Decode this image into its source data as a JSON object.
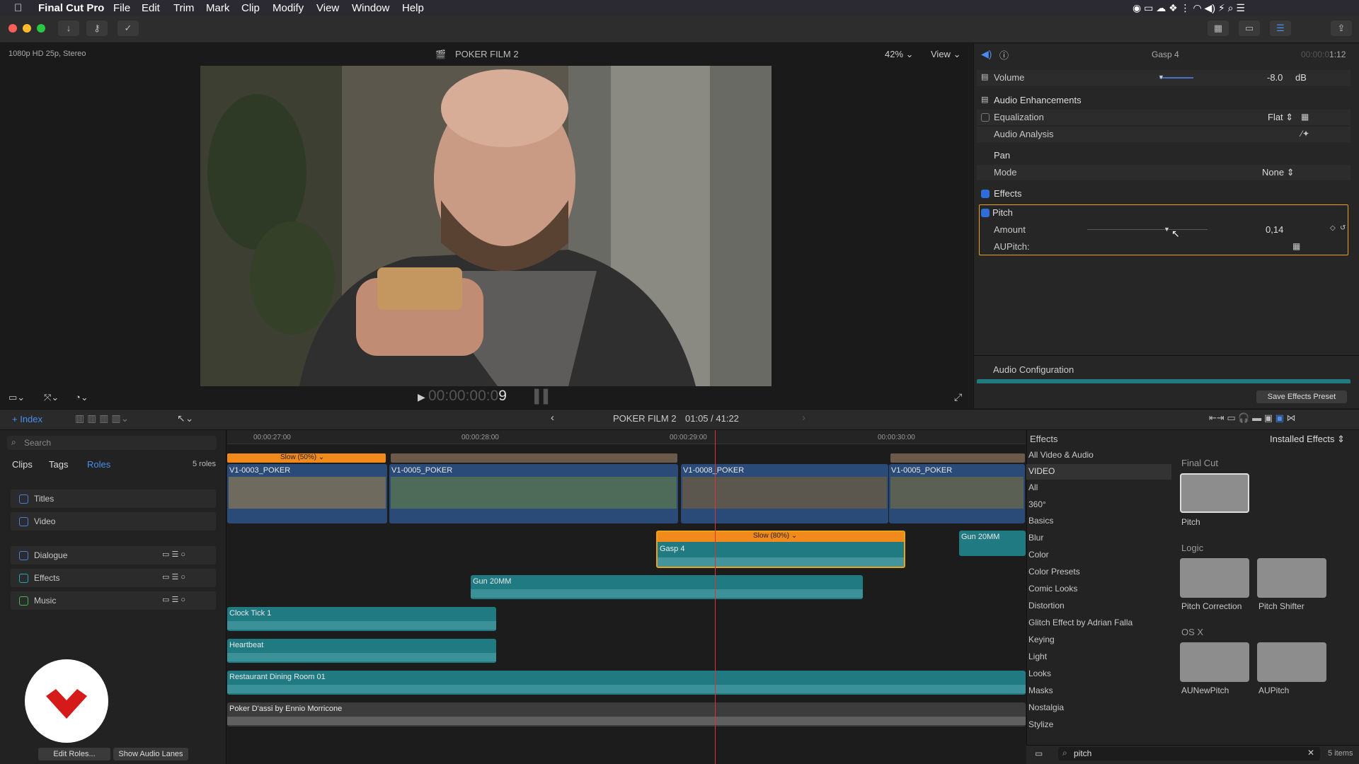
{
  "menu": {
    "app": "Final Cut Pro",
    "items": [
      "File",
      "Edit",
      "Trim",
      "Mark",
      "Clip",
      "Modify",
      "View",
      "Window",
      "Help"
    ]
  },
  "viewer": {
    "format": "1080p HD 25p, Stereo",
    "project": "POKER FILM 2",
    "zoom": "42%",
    "view": "View",
    "timecode": "00:00:00:09"
  },
  "inspector": {
    "clip": "Gasp 4",
    "duration": "1:12",
    "volume_label": "Volume",
    "volume_value": "-8.0",
    "volume_unit": "dB",
    "enh": "Audio Enhancements",
    "eq": "Equalization",
    "eq_value": "Flat",
    "analysis": "Audio Analysis",
    "pan": "Pan",
    "mode": "Mode",
    "mode_value": "None",
    "effects": "Effects",
    "pitch": "Pitch",
    "amount": "Amount",
    "amount_value": "0,14",
    "aupitch": "AUPitch:",
    "config": "Audio Configuration",
    "save": "Save Effects Preset"
  },
  "timeline_header": {
    "index": "Index",
    "project": "POKER FILM 2",
    "position": "01:05 / 41:22",
    "ruler": [
      "00:00:27:00",
      "00:00:28:00",
      "00:00:29:00",
      "00:00:30:00"
    ]
  },
  "index": {
    "search": "Search",
    "tabs": [
      "Clips",
      "Tags",
      "Roles"
    ],
    "count": "5 roles",
    "roles": [
      "Titles",
      "Video",
      "Dialogue",
      "Effects",
      "Music"
    ],
    "edit_roles": "Edit Roles...",
    "show_lanes": "Show Audio Lanes"
  },
  "clips": {
    "speed1": "Slow (50%)",
    "speed2": "Slow (80%)",
    "v1": "V1-0003_POKER",
    "v2": "V1-0005_POKER",
    "v3": "V1-0008_POKER",
    "v4": "V1-0005_POKER",
    "gasp": "Gasp 4",
    "gun1": "Gun 20MM",
    "gun2": "Gun 20MM",
    "clock": "Clock Tick 1",
    "heart": "Heartbeat",
    "restaurant": "Restaurant Dining Room 01",
    "music": "Poker D'assi by Ennio Morricone"
  },
  "browser": {
    "title": "Effects",
    "installed": "Installed Effects",
    "categories": [
      "All Video & Audio",
      "VIDEO",
      "All",
      "360°",
      "Basics",
      "Blur",
      "Color",
      "Color Presets",
      "Comic Looks",
      "Distortion",
      "Glitch Effect by Adrian Falla",
      "Keying",
      "Light",
      "Looks",
      "Masks",
      "Nostalgia",
      "Stylize"
    ],
    "groups": [
      {
        "name": "Final Cut",
        "items": [
          "Pitch"
        ]
      },
      {
        "name": "Logic",
        "items": [
          "Pitch Correction",
          "Pitch Shifter"
        ]
      },
      {
        "name": "OS X",
        "items": [
          "AUNewPitch",
          "AUPitch"
        ]
      }
    ],
    "search": "pitch",
    "count": "5 items"
  },
  "colors": {
    "accent": "#2f6ed8",
    "selection": "#e8a317",
    "video_clip": "#2a4a78",
    "audio_clip": "#1f7a82",
    "speed_bar": "#f28a1b"
  }
}
